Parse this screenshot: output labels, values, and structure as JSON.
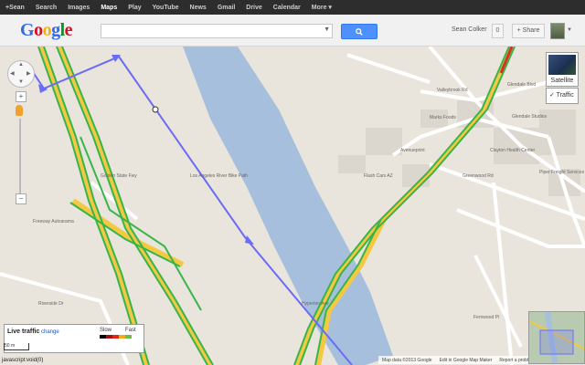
{
  "topbar": {
    "items": [
      {
        "label": "+Sean",
        "active": false
      },
      {
        "label": "Search",
        "active": false
      },
      {
        "label": "Images",
        "active": false
      },
      {
        "label": "Maps",
        "active": true
      },
      {
        "label": "Play",
        "active": false
      },
      {
        "label": "YouTube",
        "active": false
      },
      {
        "label": "News",
        "active": false
      },
      {
        "label": "Gmail",
        "active": false
      },
      {
        "label": "Drive",
        "active": false
      },
      {
        "label": "Calendar",
        "active": false
      },
      {
        "label": "More ▾",
        "active": false
      }
    ]
  },
  "header": {
    "logo": {
      "l1": "G",
      "l2": "o",
      "l3": "o",
      "l4": "g",
      "l5": "l",
      "l6": "e"
    },
    "search_value": "",
    "user_name": "Sean Colker",
    "notification_count": "0",
    "share_label": "+ Share"
  },
  "map_controls": {
    "satellite_label": "Satellite",
    "traffic_label": "✓ Traffic"
  },
  "legend": {
    "title": "Live traffic",
    "change_label": "change",
    "slow_label": "Slow",
    "fast_label": "Fast",
    "swatch_colors": [
      "#000000",
      "#a11111",
      "#e2231a",
      "#f5a623",
      "#6cbd45"
    ]
  },
  "scale_label": "50 m",
  "status_url": "javascript:void(0)",
  "footer": {
    "attribution": "Map data ©2013 Google",
    "edit_link": "Edit in Google Map Maker",
    "report_link": "Report a problem"
  },
  "map_labels": {
    "valleybrook": "Valleybrook Rd",
    "glendale_blvd": "Glendale Blvd",
    "marks": "Marks Foods",
    "glendale_studios": "Glendale Studios",
    "avenue": "Avenueprint",
    "clayton": "Clayton Health Center",
    "flash": "Flash Cars AZ",
    "greenwood": "Greenwood Rd",
    "piper": "Piper Freight Services",
    "riverside": "Riverside Dr",
    "golden_state": "Golden State Fwy",
    "hyperion": "Hyperion Ave",
    "fernwood": "Fernwood Pl",
    "freeway": "Freeway Autoarama",
    "los_angeles_river": "Los Angeles River Bike Path"
  },
  "colors": {
    "freeway_yellow": "#f5c842",
    "traffic_green": "#38b54a",
    "route_blue": "#6a6cf5",
    "river_blue": "#a5bfdd",
    "land": "#e9e5dc",
    "building": "#dcd7ce"
  }
}
